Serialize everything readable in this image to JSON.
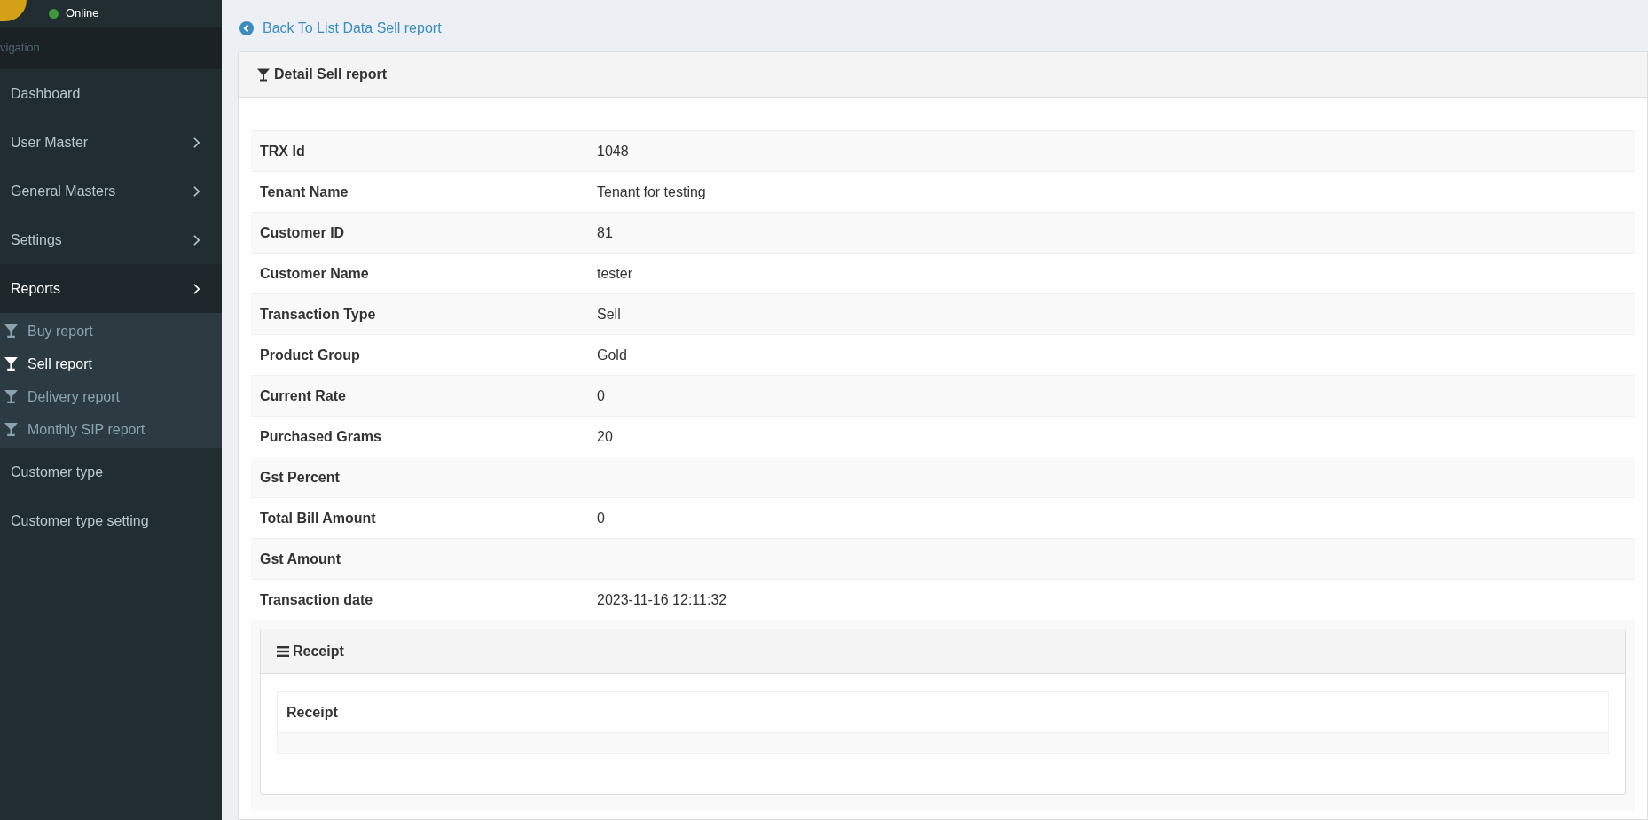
{
  "user": {
    "status": "Online"
  },
  "sidebar": {
    "header": "vigation",
    "items": [
      {
        "label": "Dashboard",
        "expandable": false,
        "active": false
      },
      {
        "label": "User Master",
        "expandable": true,
        "active": false
      },
      {
        "label": "General Masters",
        "expandable": true,
        "active": false
      },
      {
        "label": "Settings",
        "expandable": true,
        "active": false
      },
      {
        "label": "Reports",
        "expandable": true,
        "active": true,
        "children": [
          {
            "label": "Buy report",
            "selected": false
          },
          {
            "label": "Sell report",
            "selected": true
          },
          {
            "label": "Delivery report",
            "selected": false
          },
          {
            "label": "Monthly SIP report",
            "selected": false
          }
        ]
      },
      {
        "label": "Customer type",
        "expandable": false,
        "active": false
      },
      {
        "label": "Customer type setting",
        "expandable": false,
        "active": false
      }
    ]
  },
  "back_link": "Back To List Data Sell report",
  "detail": {
    "title": "Detail Sell report",
    "rows": [
      {
        "label": "TRX Id",
        "value": "1048"
      },
      {
        "label": "Tenant Name",
        "value": "Tenant for testing"
      },
      {
        "label": "Customer ID",
        "value": "81"
      },
      {
        "label": "Customer Name",
        "value": "tester"
      },
      {
        "label": "Transaction Type",
        "value": "Sell"
      },
      {
        "label": "Product Group",
        "value": "Gold"
      },
      {
        "label": "Current Rate",
        "value": "0"
      },
      {
        "label": "Purchased Grams",
        "value": "20"
      },
      {
        "label": "Gst Percent",
        "value": ""
      },
      {
        "label": "Total Bill Amount",
        "value": "0"
      },
      {
        "label": "Gst Amount",
        "value": ""
      },
      {
        "label": "Transaction date",
        "value": "2023-11-16 12:11:32"
      }
    ]
  },
  "receipt": {
    "title": "Receipt",
    "columns": [
      "Receipt"
    ]
  }
}
